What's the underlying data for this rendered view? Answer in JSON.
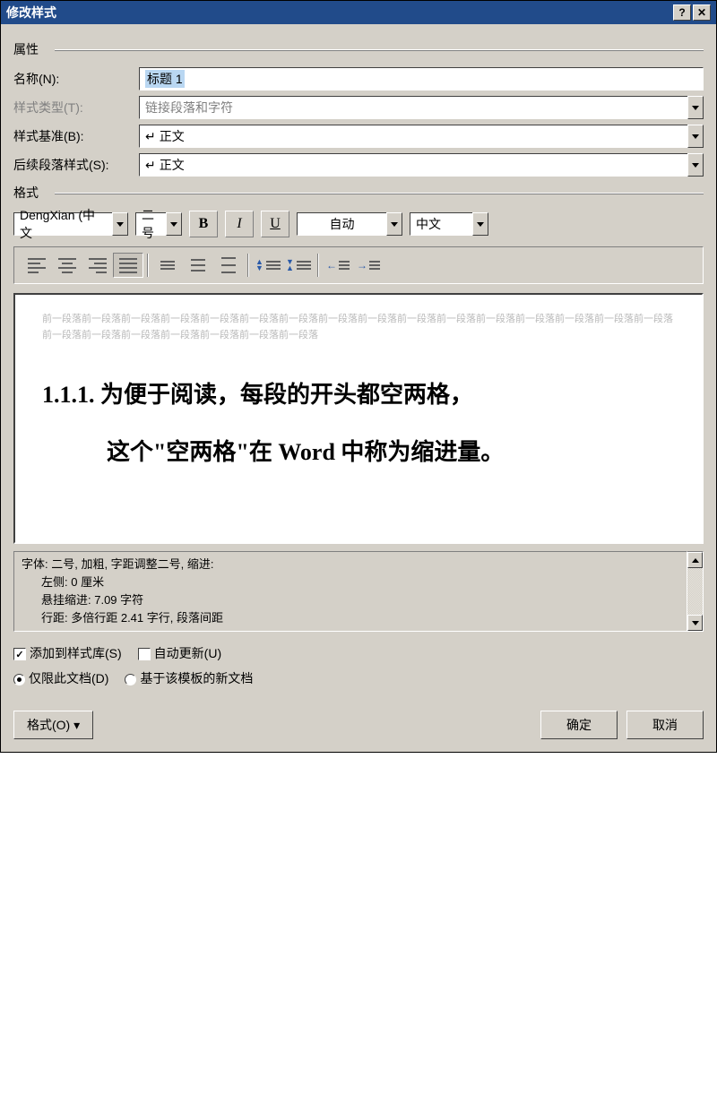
{
  "title": "修改样式",
  "groups": {
    "props": "属性",
    "format": "格式"
  },
  "labels": {
    "name": "名称(N):",
    "type": "样式类型(T):",
    "based": "样式基准(B):",
    "next": "后续段落样式(S):"
  },
  "fields": {
    "name_value": "标题 1",
    "type_value": "链接段落和字符",
    "based_value": "正文",
    "next_value": "正文"
  },
  "fmt": {
    "font": "DengXian (中文",
    "size": "二号",
    "bold": "B",
    "italic": "I",
    "underline": "U",
    "color": "自动",
    "lang": "中文"
  },
  "preview": {
    "gray_unit": "前一段落",
    "main_l1": "1.1.1. 为便于阅读，每段的开头都空两格，",
    "main_l2": "这个\"空两格\"在 Word 中称为缩进量。"
  },
  "desc": {
    "l1": "字体: 二号, 加粗, 字距调整二号, 缩进:",
    "l2": "左侧:  0 厘米",
    "l3": "悬挂缩进: 7.09 字符",
    "l4": "行距: 多倍行距 2.41 字行, 段落间距"
  },
  "opts": {
    "addQuick": "添加到样式库(S)",
    "autoUpdate": "自动更新(U)",
    "onlyDoc": "仅限此文档(D)",
    "onTemplate": "基于该模板的新文档"
  },
  "buttons": {
    "format": "格式(O)",
    "ok": "确定",
    "cancel": "取消"
  }
}
